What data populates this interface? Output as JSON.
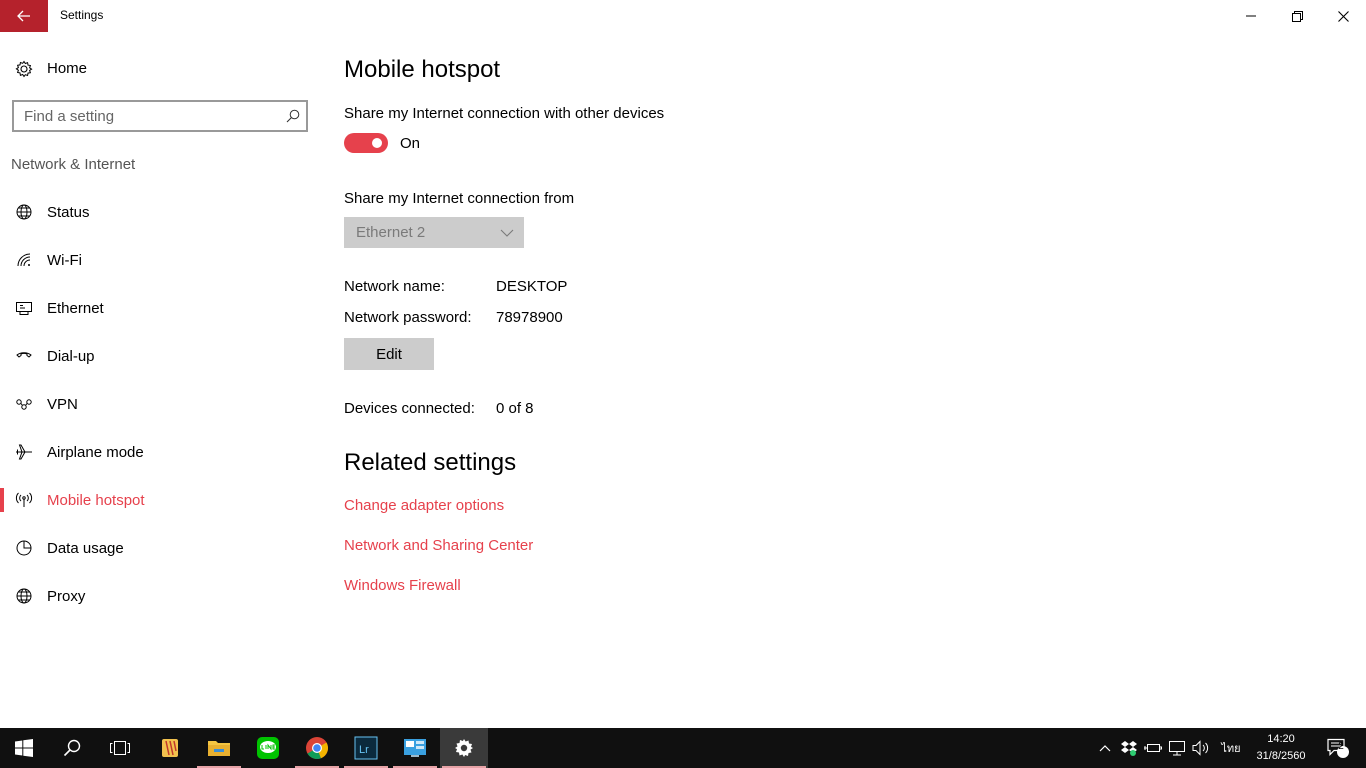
{
  "window": {
    "title": "Settings"
  },
  "sidebar": {
    "home_label": "Home",
    "search_placeholder": "Find a setting",
    "section_title": "Network & Internet",
    "items": [
      {
        "label": "Status",
        "icon": "globe-icon"
      },
      {
        "label": "Wi-Fi",
        "icon": "wifi-icon"
      },
      {
        "label": "Ethernet",
        "icon": "ethernet-icon"
      },
      {
        "label": "Dial-up",
        "icon": "dialup-icon"
      },
      {
        "label": "VPN",
        "icon": "vpn-icon"
      },
      {
        "label": "Airplane mode",
        "icon": "airplane-icon"
      },
      {
        "label": "Mobile hotspot",
        "icon": "hotspot-icon",
        "active": true
      },
      {
        "label": "Data usage",
        "icon": "data-usage-icon"
      },
      {
        "label": "Proxy",
        "icon": "globe-icon"
      }
    ]
  },
  "main": {
    "title": "Mobile hotspot",
    "share_label": "Share my Internet connection with other devices",
    "toggle_state": "On",
    "from_label": "Share my Internet connection from",
    "from_value": "Ethernet 2",
    "network_name_label": "Network name:",
    "network_name": "DESKTOP",
    "network_password_label": "Network password:",
    "network_password": "78978900",
    "edit_label": "Edit",
    "devices_label": "Devices connected:",
    "devices_value": "0 of 8",
    "related_title": "Related settings",
    "links": [
      "Change adapter options",
      "Network and Sharing Center",
      "Windows Firewall"
    ]
  },
  "taskbar": {
    "apps": [
      "start-icon",
      "search-icon",
      "task-view-icon",
      "app-icon",
      "file-explorer-icon",
      "line-icon",
      "chrome-icon",
      "lightroom-icon",
      "control-panel-icon",
      "settings-icon"
    ],
    "language": "ไทย",
    "time": "14:20",
    "date": "31/8/2560",
    "notification_count": "2"
  },
  "colors": {
    "accent": "#e6414c",
    "titlebar_back": "#b5222c",
    "taskbar": "#101010",
    "control_gray": "#cccccc"
  }
}
